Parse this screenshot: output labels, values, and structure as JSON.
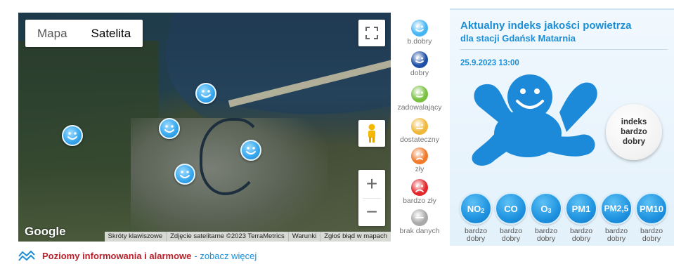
{
  "map": {
    "type_buttons": [
      {
        "label": "Mapa",
        "active": false
      },
      {
        "label": "Satelita",
        "active": true
      }
    ],
    "zoom_in_label": "+",
    "zoom_out_label": "−",
    "google_label": "Google",
    "attribution": [
      "Skróty klawiszowe",
      "Zdjęcie satelitarne ©2023 TerraMetrics",
      "Warunki",
      "Zgłoś błąd w mapach"
    ],
    "marker_icon": "smiley-face-icon",
    "marker_color": "#3aa9ef"
  },
  "legend": {
    "items": [
      {
        "label": "b.dobry",
        "color": "#45b5f4"
      },
      {
        "label": "dobry",
        "color": "#1e4fa6"
      },
      {
        "label": "zadowalający",
        "color": "#7ac142"
      },
      {
        "label": "dostateczny",
        "color": "#f0b83a"
      },
      {
        "label": "zły",
        "color": "#f07a2c"
      },
      {
        "label": "bardzo zły",
        "color": "#e2262c"
      },
      {
        "label": "brak danych",
        "color": "#a8a8a8"
      }
    ]
  },
  "panel": {
    "title": "Aktualny indeks jakości powietrza",
    "subtitle": "dla stacji Gdańsk Matarnia",
    "date": "25.9.2023 13:00",
    "index_lines": [
      "indeks",
      "bardzo",
      "dobry"
    ],
    "mascot_color": "#1c8ad8",
    "pollutants": [
      {
        "name": "NO",
        "sub": "2",
        "status": [
          "bardzo",
          "dobry"
        ]
      },
      {
        "name": "CO",
        "sub": "",
        "status": [
          "bardzo",
          "dobry"
        ]
      },
      {
        "name": "O",
        "sub": "3",
        "status": [
          "bardzo",
          "dobry"
        ]
      },
      {
        "name": "PM1",
        "sub": "",
        "status": [
          "bardzo",
          "dobry"
        ]
      },
      {
        "name": "PM2,5",
        "sub": "",
        "status": [
          "bardzo",
          "dobry"
        ]
      },
      {
        "name": "PM10",
        "sub": "",
        "status": [
          "bardzo",
          "dobry"
        ]
      }
    ]
  },
  "footer": {
    "icon": "alert-levels-icon",
    "text": "Poziomy informowania i alarmowe",
    "link": "- zobacz więcej"
  }
}
